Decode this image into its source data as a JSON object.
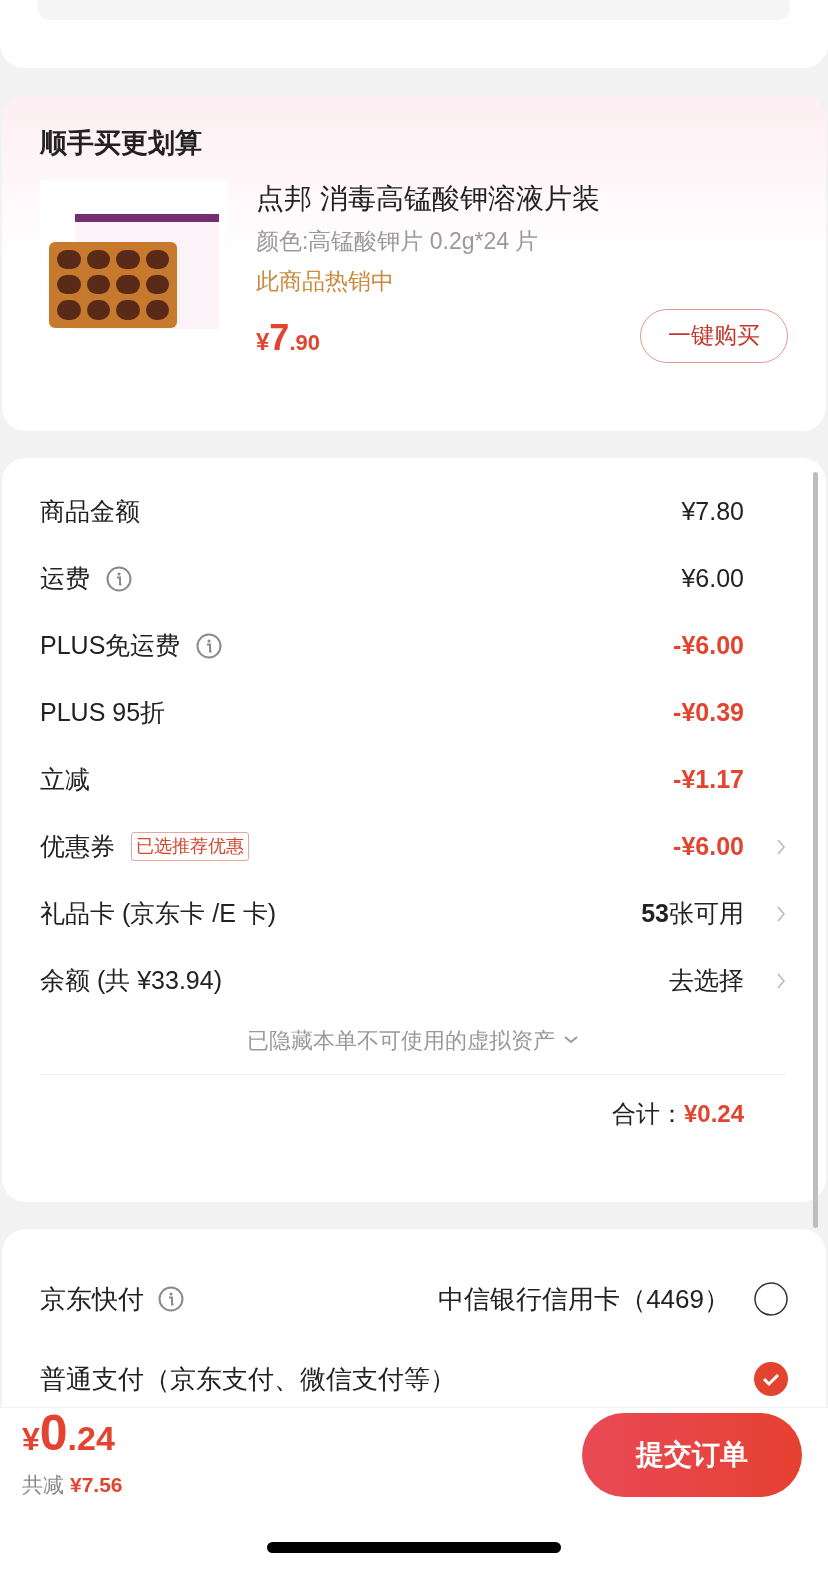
{
  "recommend": {
    "title": "顺手买更划算",
    "product": {
      "name": "点邦 消毒高锰酸钾溶液片装",
      "spec": "颜色:高锰酸钾片 0.2g*24 片",
      "promo": "此商品热销中",
      "price": {
        "symbol": "¥",
        "integer": "7",
        "decimal": ".90"
      },
      "button": "一键购买"
    }
  },
  "summary": {
    "rows": [
      {
        "label": "商品金额",
        "info": false,
        "value": "¥7.80",
        "kind": "normal",
        "chevron": false
      },
      {
        "label": "运费",
        "info": true,
        "value": "¥6.00",
        "kind": "normal",
        "chevron": false
      },
      {
        "label": "PLUS免运费",
        "info": true,
        "value": "-¥6.00",
        "kind": "discount",
        "chevron": false
      },
      {
        "label": "PLUS 95折",
        "info": false,
        "value": "-¥0.39",
        "kind": "discount",
        "chevron": false
      },
      {
        "label": "立减",
        "info": false,
        "value": "-¥1.17",
        "kind": "discount",
        "chevron": false
      },
      {
        "label": "优惠券",
        "info": false,
        "tag": "已选推荐优惠",
        "value": "-¥6.00",
        "kind": "discount",
        "chevron": true
      },
      {
        "label": "礼品卡 (京东卡 /E 卡)",
        "info": false,
        "value": "**53**张可用",
        "kind": "normal",
        "chevron": true
      },
      {
        "label": "余额 (共 ¥33.94)",
        "info": false,
        "value": "去选择",
        "kind": "normal",
        "chevron": true
      }
    ],
    "hidden_note": "已隐藏本单不可使用的虚拟资产",
    "total_label": "合计：",
    "total_value": "¥0.24"
  },
  "payment": [
    {
      "label": "京东快付",
      "info": true,
      "detail": "中信银行信用卡（4469）",
      "selected": false
    },
    {
      "label": "普通支付（京东支付、微信支付等）",
      "info": false,
      "selected": true
    }
  ],
  "footer": {
    "price": {
      "symbol": "¥",
      "integer": "0",
      "decimal": ".24"
    },
    "saved_label": "共减",
    "saved_value": "¥7.56",
    "submit": "提交订单"
  }
}
